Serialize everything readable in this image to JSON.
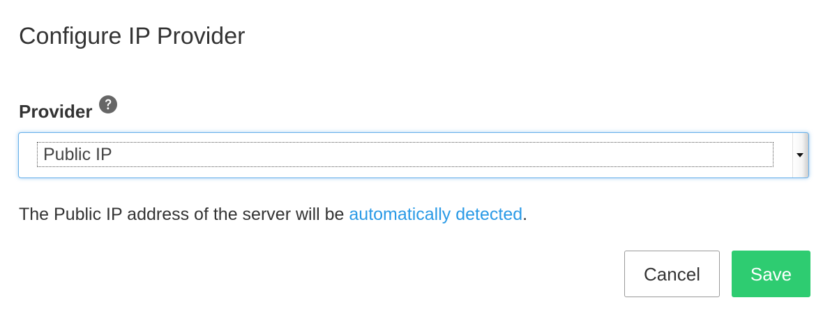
{
  "dialog": {
    "title": "Configure IP Provider"
  },
  "provider_field": {
    "label": "Provider",
    "help_icon": "question-circle-icon",
    "selected_value": "Public IP"
  },
  "description": {
    "text_before": "The Public IP address of the server will be ",
    "link_text": "automatically detected",
    "text_after": "."
  },
  "buttons": {
    "cancel_label": "Cancel",
    "save_label": "Save"
  },
  "colors": {
    "save_button": "#2ecc71",
    "link": "#2a9ae6",
    "focus_border": "#66afe9"
  }
}
